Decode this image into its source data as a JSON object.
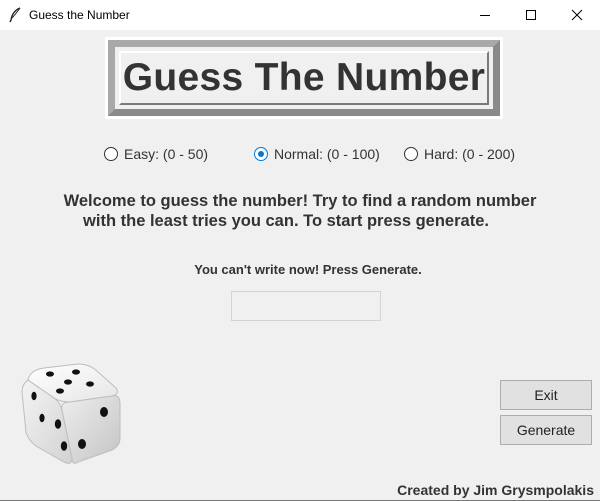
{
  "window": {
    "title": "Guess the Number",
    "icon": "feather-icon",
    "controls": [
      "minimize-icon",
      "maximize-icon",
      "close-icon"
    ]
  },
  "headline": "Guess The Number",
  "difficulty": {
    "selected": "normal",
    "options": [
      {
        "id": "easy",
        "label": "Easy: (0 - 50)",
        "checked": false
      },
      {
        "id": "normal",
        "label": "Normal: (0 - 100)",
        "checked": true
      },
      {
        "id": "hard",
        "label": "Hard: (0 - 200)",
        "checked": false
      }
    ]
  },
  "welcome": {
    "line1": "Welcome to guess the number! Try to find a random number",
    "line2": "with the least tries you can. To start press generate."
  },
  "status_text": "You can't write now! Press Generate.",
  "guess_input": {
    "value": "",
    "placeholder": ""
  },
  "dice": {
    "icon": "dice-icon"
  },
  "buttons": {
    "exit": "Exit",
    "generate": "Generate"
  },
  "credit": "Created by Jim Grysmpolakis",
  "colors": {
    "window_bg": "#f0f0f0",
    "accent": "#0078d7",
    "text": "#333333"
  }
}
